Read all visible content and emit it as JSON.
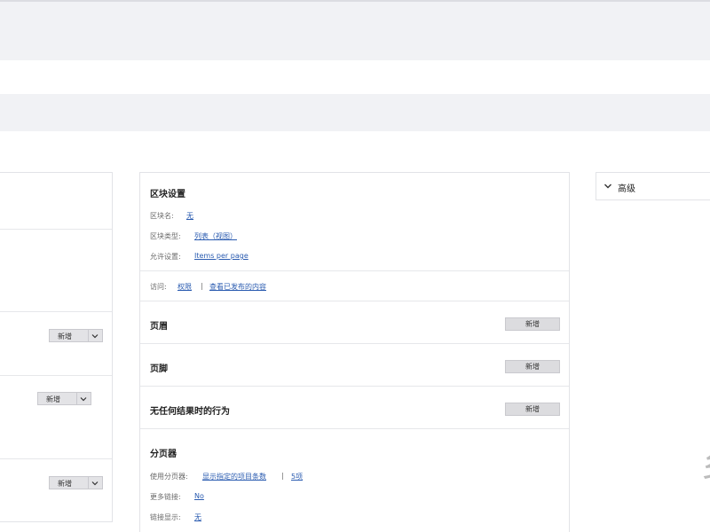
{
  "left_panel": {
    "split_buttons": [
      {
        "label": "新增"
      },
      {
        "label": "新增"
      },
      {
        "label": "新增"
      }
    ]
  },
  "block_settings": {
    "title": "区块设置",
    "rows": [
      {
        "label": "区块名:",
        "value": "无"
      },
      {
        "label": "区块类型:",
        "value": "列表（视图）"
      },
      {
        "label": "允许设置:",
        "value": "Items per page"
      }
    ],
    "access": {
      "label": "访问:",
      "link1": "权限",
      "separator": "|",
      "link2": "查看已发布的内容"
    }
  },
  "sections": [
    {
      "title": "页眉",
      "button": "新增"
    },
    {
      "title": "页脚",
      "button": "新增"
    },
    {
      "title": "无任何结果时的行为",
      "button": "新增"
    }
  ],
  "pager": {
    "title": "分页器",
    "use_label": "使用分页器:",
    "use_value": "显示指定的项目条数",
    "separator": "|",
    "use_count": "5项",
    "more_label": "更多链接:",
    "more_value": "No",
    "link_label": "链接显示:",
    "link_value": "无"
  },
  "advanced": {
    "label": "高级",
    "icon": "chevron-down-icon"
  }
}
